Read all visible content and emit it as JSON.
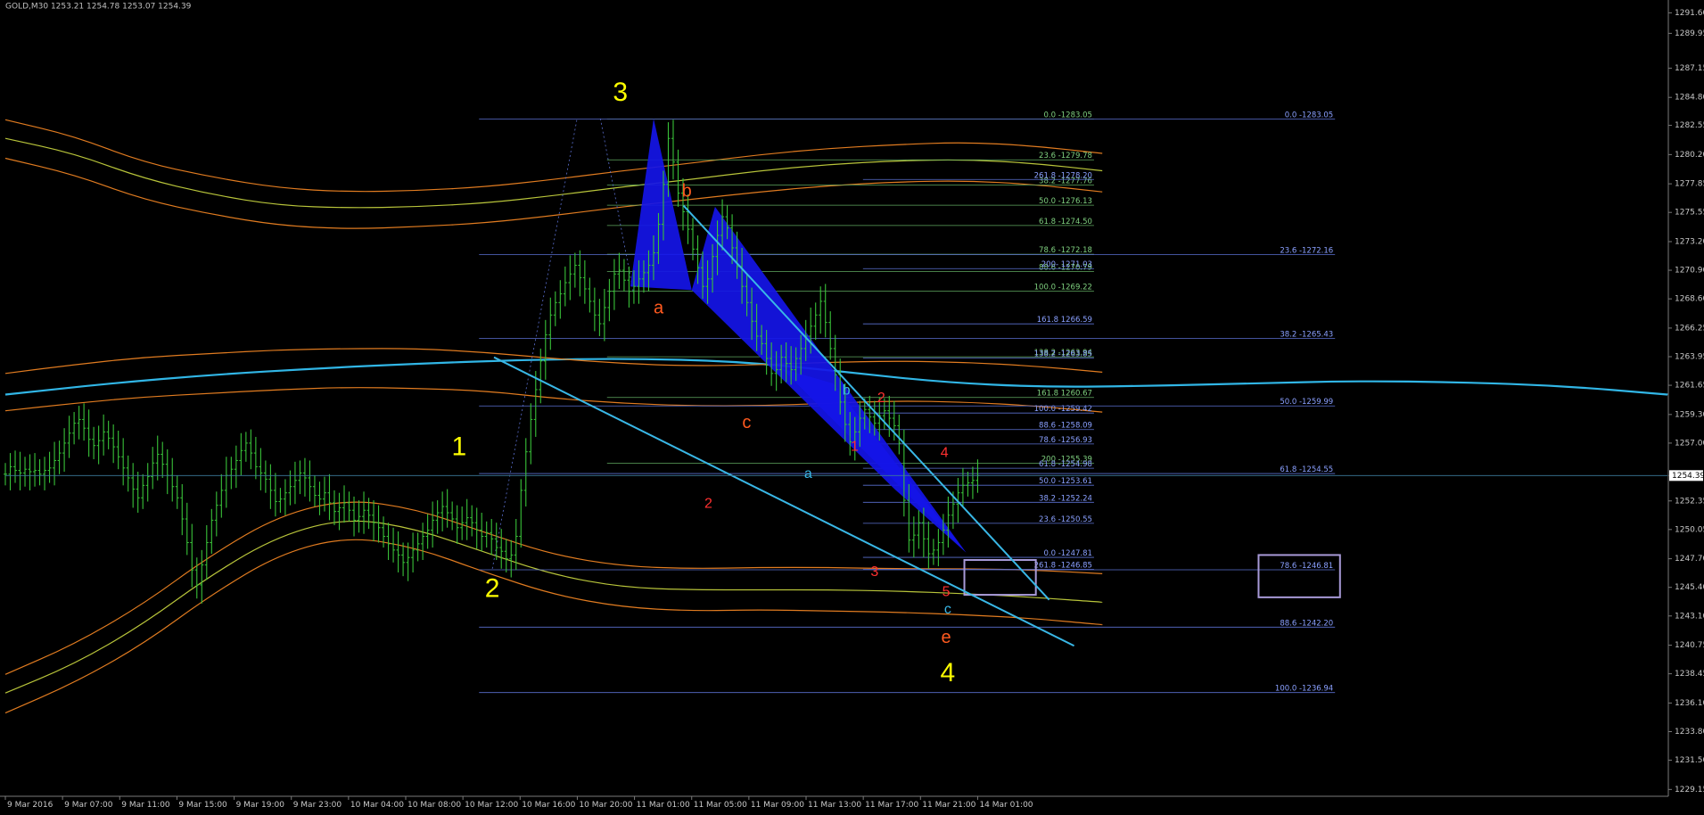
{
  "window": {
    "title": "GOLD,M30  1253.21 1254.78 1253.07 1254.39"
  },
  "colors": {
    "background": "#000000",
    "axis": "#7a7a7a",
    "candle": "#39c239",
    "fib_green": "#5fa85f",
    "fib_blue": "#5a6fd0",
    "fib_text_green": "#7fd07f",
    "fib_text_blue": "#8aa0ff",
    "ma_cyan": "#31b6e6",
    "ma_orange": "#e07b20",
    "ma_yellowgreen": "#b8c43a",
    "ma_green": "#5fbf3a",
    "trendline": "#39b7e6",
    "harmonic_fill": "#1515e8",
    "wave_yellow": "#ffff00",
    "wave_red": "#ff3030",
    "wave_orange": "#ff5a1f",
    "wave_cyan": "#39b7e6",
    "box": "#a89ad8",
    "price_label_bg": "#ffffff",
    "price_label_text": "#000000"
  },
  "chart_data": {
    "type": "candlestick",
    "symbol": "GOLD",
    "timeframe": "M30",
    "ohlc_header": "1253.21 1254.78 1253.07 1254.39",
    "ylim": [
      1228.6,
      1292.2
    ],
    "y_ticks": [
      "1291.60",
      "1289.95",
      "1287.15",
      "1284.80",
      "1282.55",
      "1280.20",
      "1277.85",
      "1275.55",
      "1273.20",
      "1270.90",
      "1268.60",
      "1266.25",
      "1263.95",
      "1261.65",
      "1259.30",
      "1257.00",
      "1254.39",
      "1252.35",
      "1250.05",
      "1247.70",
      "1245.40",
      "1243.10",
      "1240.75",
      "1238.45",
      "1236.10",
      "1233.80",
      "1231.50",
      "1229.15"
    ],
    "current_price": "1254.39",
    "current_price_value": 1254.39,
    "x_ticks": [
      "9 Mar 2016",
      "9 Mar 07:00",
      "9 Mar 11:00",
      "9 Mar 15:00",
      "9 Mar 19:00",
      "9 Mar 23:00",
      "10 Mar 04:00",
      "10 Mar 08:00",
      "10 Mar 12:00",
      "10 Mar 16:00",
      "10 Mar 20:00",
      "11 Mar 01:00",
      "11 Mar 05:00",
      "11 Mar 09:00",
      "11 Mar 13:00",
      "11 Mar 17:00",
      "11 Mar 21:00",
      "14 Mar 01:00"
    ],
    "candles_close": [
      1254.5,
      1255.1,
      1254.8,
      1254.6,
      1254.9,
      1254.7,
      1254.8,
      1254.5,
      1254.8,
      1255.0,
      1255.6,
      1256.2,
      1257.0,
      1257.8,
      1258.6,
      1258.9,
      1258.2,
      1257.3,
      1256.8,
      1257.2,
      1257.9,
      1257.4,
      1256.7,
      1255.9,
      1255.0,
      1254.2,
      1253.3,
      1252.6,
      1253.6,
      1254.3,
      1255.4,
      1256.1,
      1255.3,
      1254.4,
      1253.5,
      1252.6,
      1250.9,
      1249.0,
      1246.8,
      1245.6,
      1247.2,
      1249.0,
      1250.8,
      1252.0,
      1253.2,
      1254.4,
      1254.9,
      1255.6,
      1256.4,
      1257.0,
      1256.2,
      1255.1,
      1254.6,
      1254.1,
      1253.2,
      1252.3,
      1252.5,
      1253.0,
      1253.5,
      1254.0,
      1254.6,
      1254.2,
      1253.5,
      1252.8,
      1252.5,
      1253.0,
      1252.2,
      1251.5,
      1251.8,
      1252.2,
      1251.6,
      1250.8,
      1251.1,
      1251.6,
      1251.2,
      1250.6,
      1250.2,
      1249.5,
      1248.9,
      1248.4,
      1248.0,
      1247.4,
      1247.8,
      1248.4,
      1248.9,
      1249.5,
      1250.0,
      1250.8,
      1251.4,
      1251.9,
      1251.4,
      1250.9,
      1250.2,
      1250.6,
      1251.0,
      1250.6,
      1250.0,
      1249.5,
      1249.8,
      1249.3,
      1248.6,
      1248.3,
      1247.7,
      1248.0,
      1249.5,
      1253.2,
      1256.3,
      1258.9,
      1261.3,
      1263.6,
      1265.7,
      1267.3,
      1268.3,
      1269.0,
      1269.9,
      1270.6,
      1271.3,
      1270.3,
      1269.4,
      1268.4,
      1267.3,
      1266.6,
      1267.9,
      1269.2,
      1270.6,
      1270.9,
      1270.1,
      1269.2,
      1269.6,
      1270.2,
      1270.7,
      1271.3,
      1272.3,
      1274.6,
      1277.8,
      1281.5,
      1279.6,
      1277.1,
      1275.6,
      1274.2,
      1272.6,
      1271.1,
      1269.6,
      1270.2,
      1272.0,
      1273.7,
      1275.2,
      1274.3,
      1272.7,
      1271.2,
      1269.6,
      1268.3,
      1266.8,
      1265.6,
      1265.0,
      1263.8,
      1262.6,
      1262.9,
      1263.9,
      1263.4,
      1262.9,
      1263.8,
      1264.6,
      1265.6,
      1266.4,
      1267.3,
      1268.4,
      1266.7,
      1264.6,
      1262.5,
      1260.3,
      1258.5,
      1257.1,
      1257.9,
      1259.0,
      1259.7,
      1259.1,
      1258.6,
      1259.2,
      1259.6,
      1259.0,
      1258.4,
      1257.0,
      1252.4,
      1249.2,
      1249.6,
      1250.6,
      1249.3,
      1248.1,
      1248.4,
      1249.0,
      1250.0,
      1251.2,
      1252.1,
      1253.0,
      1253.6,
      1253.8,
      1254.0,
      1254.39
    ],
    "series": [
      {
        "name": "MA cyan",
        "color_key": "ma_cyan",
        "values": [
          1260.9,
          1261.8,
          1262.5,
          1263.0,
          1263.4,
          1263.7,
          1263.8,
          1263.6,
          1262.8,
          1261.9,
          1261.5,
          1261.6,
          1261.8,
          1262.0,
          1261.9,
          1261.6,
          1260.9
        ]
      },
      {
        "name": "Upper band outer",
        "color_key": "ma_orange",
        "values": [
          1283.0,
          1281.7,
          1279.6,
          1278.4,
          1277.5,
          1277.2,
          1277.3,
          1277.6,
          1278.2,
          1278.9,
          1279.5,
          1280.2,
          1280.7,
          1281.0,
          1281.2,
          1280.9,
          1280.3
        ]
      },
      {
        "name": "Upper band mid",
        "color_key": "ma_yellowgreen",
        "values": [
          1281.5,
          1280.3,
          1278.3,
          1277.0,
          1276.1,
          1275.9,
          1276.0,
          1276.3,
          1276.9,
          1277.6,
          1278.2,
          1278.9,
          1279.4,
          1279.7,
          1279.8,
          1279.5,
          1278.9
        ]
      },
      {
        "name": "Upper band inner",
        "color_key": "ma_orange",
        "values": [
          1279.9,
          1278.6,
          1276.6,
          1275.4,
          1274.5,
          1274.2,
          1274.4,
          1274.7,
          1275.3,
          1276.0,
          1276.6,
          1277.2,
          1277.7,
          1278.0,
          1278.1,
          1277.8,
          1277.2
        ]
      },
      {
        "name": "Mid band upper",
        "color_key": "ma_orange",
        "values": [
          1262.6,
          1263.3,
          1263.9,
          1264.2,
          1264.5,
          1264.6,
          1264.6,
          1264.3,
          1263.8,
          1263.4,
          1263.2,
          1263.3,
          1263.5,
          1263.6,
          1263.5,
          1263.2,
          1262.7
        ]
      },
      {
        "name": "Mid band lower",
        "color_key": "ma_orange",
        "values": [
          1259.6,
          1260.2,
          1260.7,
          1261.0,
          1261.3,
          1261.5,
          1261.4,
          1261.2,
          1260.6,
          1260.2,
          1260.0,
          1260.0,
          1260.2,
          1260.4,
          1260.3,
          1260.0,
          1259.5
        ]
      },
      {
        "name": "Lower band 1",
        "color_key": "ma_orange",
        "values": [
          1238.4,
          1240.8,
          1244.0,
          1248.0,
          1251.2,
          1252.5,
          1251.7,
          1249.8,
          1248.0,
          1247.1,
          1246.9,
          1247.0,
          1247.0,
          1246.9,
          1246.9,
          1246.8,
          1246.5
        ]
      },
      {
        "name": "Lower band 2",
        "color_key": "ma_yellowgreen",
        "values": [
          1236.9,
          1239.2,
          1242.4,
          1246.4,
          1249.6,
          1251.0,
          1250.1,
          1248.2,
          1246.4,
          1245.4,
          1245.2,
          1245.2,
          1245.2,
          1245.1,
          1244.9,
          1244.6,
          1244.2
        ]
      },
      {
        "name": "Lower band 3",
        "color_key": "ma_orange",
        "values": [
          1235.3,
          1237.7,
          1240.8,
          1244.8,
          1248.1,
          1249.5,
          1248.6,
          1246.6,
          1244.8,
          1243.8,
          1243.5,
          1243.6,
          1243.5,
          1243.4,
          1243.2,
          1242.9,
          1242.4
        ]
      }
    ],
    "fib_levels_left": [
      {
        "label": "0.0 -1283.05",
        "price": 1283.05
      },
      {
        "label": "23.6 -1279.78",
        "price": 1279.78
      },
      {
        "label": "38.2 -1277.76",
        "price": 1277.76
      },
      {
        "label": "50.0 -1276.13",
        "price": 1276.13
      },
      {
        "label": "61.8 -1274.50",
        "price": 1274.5
      },
      {
        "label": "78.6 -1272.18",
        "price": 1272.18
      },
      {
        "label": "88.6 -1270.79",
        "price": 1270.79
      },
      {
        "label": "100.0 -1269.22",
        "price": 1269.22
      },
      {
        "label": "138.2 -1263.94",
        "price": 1263.94
      },
      {
        "label": "161.8 1260.67",
        "price": 1260.67
      },
      {
        "label": "200 -1255.39",
        "price": 1255.39
      }
    ],
    "fib_levels_mid": [
      {
        "label": "261.8 -1278.20",
        "price": 1278.2
      },
      {
        "label": "200- 1271.03",
        "price": 1271.03
      },
      {
        "label": "161.8 1266.59",
        "price": 1266.59
      },
      {
        "label": "138.2 -1263.85",
        "price": 1263.85
      },
      {
        "label": "100.0 -1259.42",
        "price": 1259.42
      },
      {
        "label": "88.6 -1258.09",
        "price": 1258.09
      },
      {
        "label": "78.6 -1256.93",
        "price": 1256.93
      },
      {
        "label": "61.8 -1254.98",
        "price": 1254.98
      },
      {
        "label": "50.0 -1253.61",
        "price": 1253.61
      },
      {
        "label": "38.2 -1252.24",
        "price": 1252.24
      },
      {
        "label": "23.6 -1250.55",
        "price": 1250.55
      },
      {
        "label": "0.0 -1247.81",
        "price": 1247.81
      },
      {
        "label": "261.8 -1246.85",
        "price": 1246.85
      }
    ],
    "fib_levels_right": [
      {
        "label": "0.0 -1283.05",
        "price": 1283.05
      },
      {
        "label": "23.6 -1272.16",
        "price": 1272.16
      },
      {
        "label": "38.2 -1265.43",
        "price": 1265.43
      },
      {
        "label": "50.0 -1259.99",
        "price": 1259.99
      },
      {
        "label": "61.8 -1254.55",
        "price": 1254.55
      },
      {
        "label": "78.6 -1246.81",
        "price": 1246.81
      },
      {
        "label": "88.6 -1242.20",
        "price": 1242.2
      },
      {
        "label": "100.0 -1236.94",
        "price": 1236.94
      }
    ],
    "wave_labels": [
      {
        "text": "3",
        "color_key": "wave_yellow",
        "size": "large",
        "price": 1285.1,
        "xi": 0.37
      },
      {
        "text": "1",
        "color_key": "wave_yellow",
        "size": "large",
        "price": 1256.6,
        "xi": 0.273
      },
      {
        "text": "2",
        "color_key": "wave_yellow",
        "size": "large",
        "price": 1245.2,
        "xi": 0.293
      },
      {
        "text": "4",
        "color_key": "wave_yellow",
        "size": "large",
        "price": 1238.4,
        "xi": 0.567
      },
      {
        "text": "b",
        "color_key": "wave_orange",
        "size": "medium",
        "price": 1277.2,
        "xi": 0.41
      },
      {
        "text": "a",
        "color_key": "wave_orange",
        "size": "medium",
        "price": 1267.8,
        "xi": 0.393
      },
      {
        "text": "c",
        "color_key": "wave_orange",
        "size": "medium",
        "price": 1258.6,
        "xi": 0.446
      },
      {
        "text": "e",
        "color_key": "wave_orange",
        "size": "medium",
        "price": 1241.3,
        "xi": 0.566
      },
      {
        "text": "b",
        "color_key": "wave_cyan",
        "size": "small",
        "price": 1261.2,
        "xi": 0.506
      },
      {
        "text": "a",
        "color_key": "wave_cyan",
        "size": "small",
        "price": 1254.5,
        "xi": 0.483
      },
      {
        "text": "c",
        "color_key": "wave_cyan",
        "size": "small",
        "price": 1243.6,
        "xi": 0.567
      },
      {
        "text": "2",
        "color_key": "wave_red",
        "size": "small",
        "price": 1252.1,
        "xi": 0.423
      },
      {
        "text": "2",
        "color_key": "wave_red",
        "size": "small",
        "price": 1260.6,
        "xi": 0.527
      },
      {
        "text": "1",
        "color_key": "wave_red",
        "size": "small",
        "price": 1256.7,
        "xi": 0.511
      },
      {
        "text": "3",
        "color_key": "wave_red",
        "size": "small",
        "price": 1246.6,
        "xi": 0.523
      },
      {
        "text": "4",
        "color_key": "wave_red",
        "size": "small",
        "price": 1256.2,
        "xi": 0.565
      },
      {
        "text": "5",
        "color_key": "wave_red",
        "size": "small",
        "price": 1245.0,
        "xi": 0.566
      }
    ]
  }
}
